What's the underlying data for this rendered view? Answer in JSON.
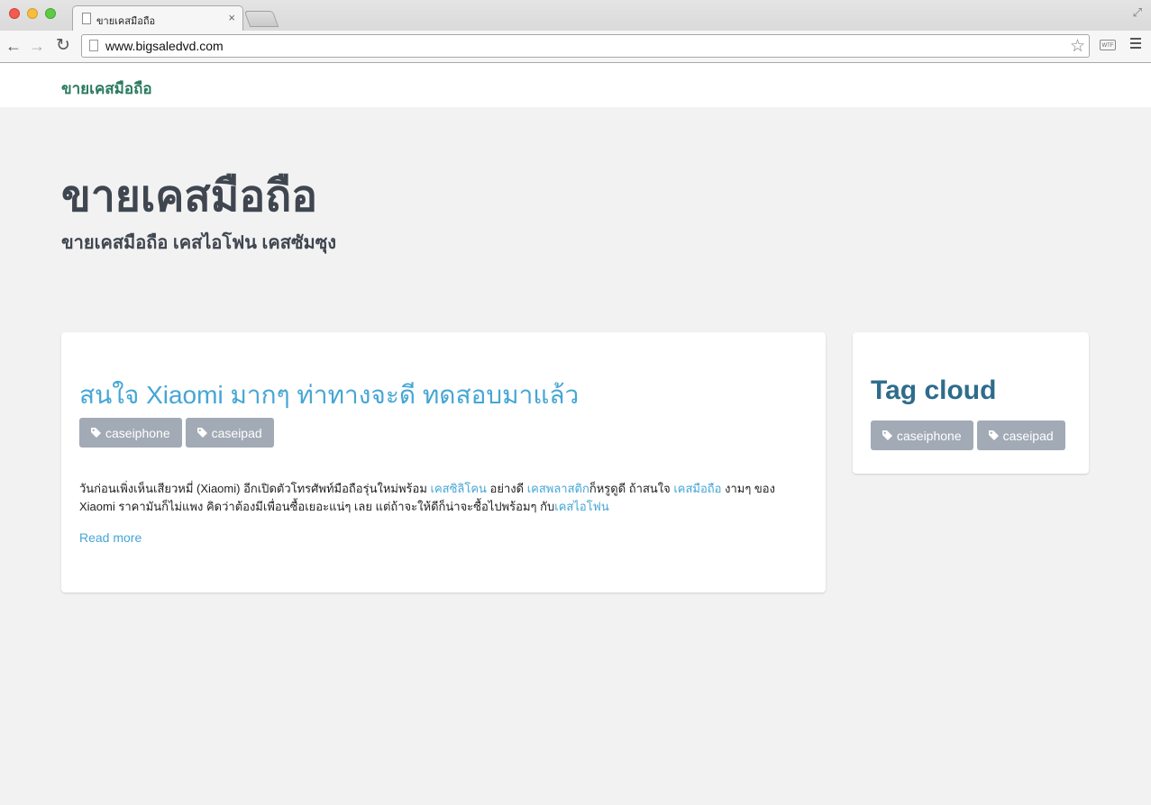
{
  "browser": {
    "tab_title": "ขายเคสมือถือ",
    "close_glyph": "×",
    "url": "www.bigsaledvd.com",
    "ext_label": "WTF"
  },
  "site": {
    "brand": "ขายเคสมือถือ",
    "hero_title": "ขายเคสมือถือ",
    "hero_subtitle": "ขายเคสมือถือ เคสไอโฟน เคสซัมซุง"
  },
  "post": {
    "title": "สนใจ Xiaomi มากๆ ท่าทางจะดี ทดสอบมาแล้ว",
    "tags": [
      "caseiphone",
      "caseipad"
    ],
    "body": [
      {
        "text": "วันก่อนเพิ่งเห็นเสียวหมี่ (Xiaomi) อีกเปิดตัวโทรศัพท์มือถือรุ่นใหม่พร้อม "
      },
      {
        "link": "เคสซิลิโคน"
      },
      {
        "text": " อย่างดี  "
      },
      {
        "link": "เคสพลาสติก"
      },
      {
        "text": "ก็หรูดูดี ถ้าสนใจ "
      },
      {
        "link": "เคสมือถือ"
      },
      {
        "text": "  งามๆ ของ Xiaomi ราคามันก็ไม่แพง  คิดว่าต้องมีเพื่อนซื้อเยอะแน่ๆ เลย แต่ถ้าจะให้ดีก็น่าจะซื้อไปพร้อมๆ กับ"
      },
      {
        "link": "เคสไอโฟน"
      }
    ],
    "read_more": "Read more"
  },
  "sidebar": {
    "title": "Tag cloud",
    "tags": [
      "caseiphone",
      "caseipad"
    ]
  },
  "colors": {
    "link": "#45a6d5",
    "brand": "#2a7b5f",
    "tag_bg": "#a2aab5",
    "heading": "#3f4650"
  }
}
